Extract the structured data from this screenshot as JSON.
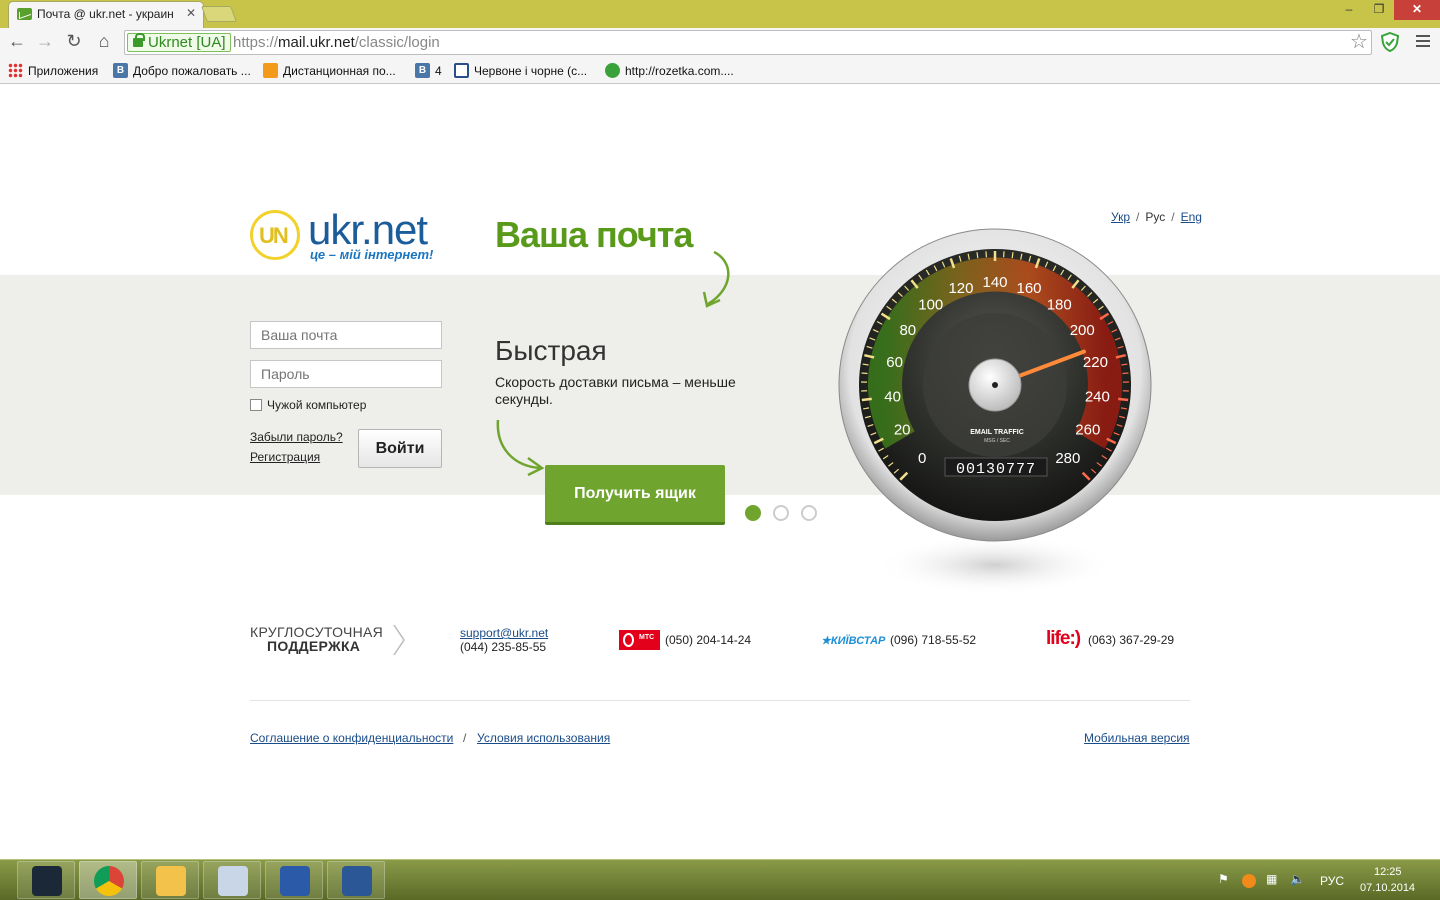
{
  "browser": {
    "tab_title": "Почта @ ukr.net - украин",
    "tab_close": "✕",
    "window_controls": {
      "minimize": "–",
      "restore": "❐",
      "close": "✕"
    },
    "ev_badge": "Ukrnet [UA]",
    "url_scheme": "https://",
    "url_host": "mail.ukr.net",
    "url_path": "/classic/login",
    "bookmarks": [
      {
        "label": "Приложения",
        "icon": "apps-icon"
      },
      {
        "label": "Добро пожаловать ...",
        "icon": "vk-icon"
      },
      {
        "label": "Дистанционная по...",
        "icon": "moodle-icon"
      },
      {
        "label": "4",
        "icon": "vk-icon"
      },
      {
        "label": "Червоне і чорне (с...",
        "icon": "book-icon"
      },
      {
        "label": "http://rozetka.com....",
        "icon": "rozetka-icon"
      }
    ]
  },
  "page": {
    "logo": {
      "mark": "UN",
      "name": "ukr.net",
      "slogan": "це – мій інтернет!"
    },
    "lang": {
      "ukr": "Укр",
      "rus": "Рус",
      "eng": "Eng",
      "sep": "/"
    },
    "login": {
      "email_placeholder": "Ваша почта",
      "password_placeholder": "Пароль",
      "foreign_pc_label": "Чужой компьютер",
      "forgot_link": "Забыли пароль?",
      "register_link": "Регистрация",
      "submit_label": "Войти"
    },
    "promo": {
      "headline": "Ваша почта",
      "slide_title": "Быстрая",
      "slide_desc": "Скорость доставки письма – меньше секунды.",
      "cta_label": "Получить ящик",
      "slides_total": 3,
      "slide_active": 1
    },
    "gauge": {
      "ticks": [
        "0",
        "20",
        "40",
        "60",
        "80",
        "100",
        "120",
        "140",
        "160",
        "180",
        "200",
        "220",
        "240",
        "260",
        "280"
      ],
      "label_top": "EMAIL TRAFFIC",
      "label_bottom": "MSG / SEC",
      "counter": "00130777",
      "needle_value": 212
    },
    "support": {
      "title_line1": "КРУГЛОСУТОЧНАЯ",
      "title_line2": "ПОДДЕРЖКА",
      "email": "support@ukr.net",
      "phone": "(044) 235-85-55",
      "mts_logo_text": "МТС",
      "mts_phone": "(050) 204-14-24",
      "kyivstar_logo_text": "★КИЇВСТАР",
      "kyivstar_phone": "(096) 718-55-52",
      "life_logo_text": "life:)",
      "life_phone": "(063) 367-29-29"
    },
    "footer": {
      "privacy": "Соглашение о конфиденциальности",
      "sep": "/",
      "terms": "Условия использования",
      "mobile": "Мобильная версия"
    }
  },
  "taskbar": {
    "apps": [
      "steam-icon",
      "chrome-icon",
      "explorer-icon",
      "calculator-icon",
      "fpc-icon",
      "word-icon"
    ],
    "active_app": "chrome-icon",
    "language": "РУС",
    "time": "12:25",
    "date": "07.10.2014"
  }
}
